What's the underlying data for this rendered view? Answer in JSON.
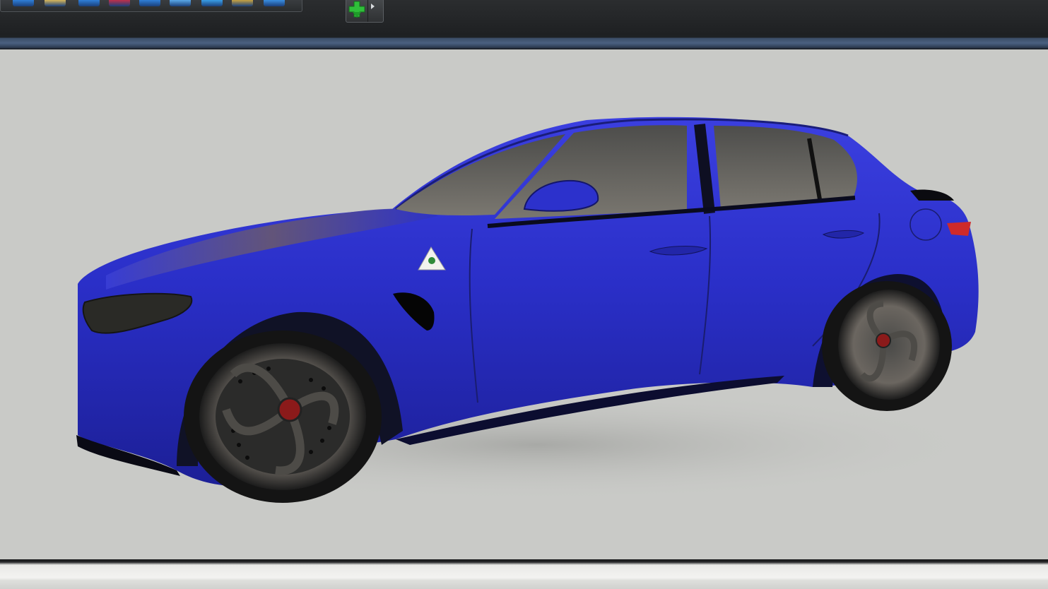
{
  "toolbar": {
    "buttons": [
      {
        "icon": "view-front-icon",
        "color": "#2f7fd8"
      },
      {
        "icon": "material-icon",
        "color": "#d8b75a"
      },
      {
        "icon": "window-icon",
        "color": "#2f7fd8"
      },
      {
        "icon": "flag-icon",
        "color": "#c0304a"
      },
      {
        "icon": "view-side-icon",
        "color": "#2f7fd8"
      },
      {
        "icon": "panel-icon",
        "color": "#5aa8e8"
      },
      {
        "icon": "globe-icon",
        "color": "#3a9ee6"
      },
      {
        "icon": "layers-icon",
        "color": "#c8a240"
      },
      {
        "icon": "window-blue-icon",
        "color": "#3a8ee0"
      }
    ],
    "add_button": {
      "icon": "green-add-icon",
      "color": "#2fbf3a"
    }
  },
  "viewport": {
    "background": "#c9cac7",
    "model": {
      "subject": "blue-sedan-3d-model",
      "body_color": "#2a2fc8",
      "badge_color": "#2f8a3a"
    }
  },
  "status": {}
}
